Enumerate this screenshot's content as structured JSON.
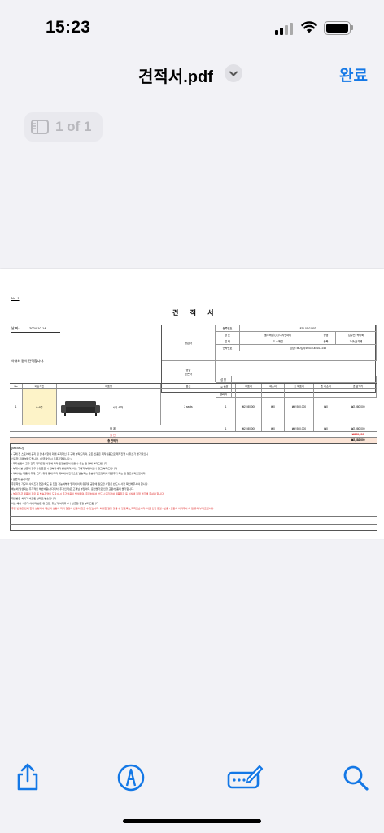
{
  "status_bar": {
    "time": "15:23"
  },
  "nav": {
    "title": "견적서.pdf",
    "done": "완료"
  },
  "pager": {
    "text": "1 of 1"
  },
  "doc": {
    "number": "No. 1",
    "heading": "견 적 서",
    "date_label": "날 짜:",
    "date_value": "2024-10-14",
    "greeting": "아래와 같이 견적합니다.",
    "supplier": {
      "side_label": "공급자",
      "recipient_label": "공급",
      "recipient_label2": "받는자",
      "reg_no_label": "등록번호",
      "reg_no": "826-01-01902",
      "name_label": "상 호",
      "name": "헬스매일 (주) 대치엔파니",
      "rep_label": "성명",
      "rep": "김수빈, 곽미화",
      "addr_label": "업 태",
      "addr": "도 소매업",
      "item_label": "종목",
      "item": "가구(상가쉐",
      "tel_label": "연락번호",
      "tel": "담당 : MD김라소 010-4544-7243",
      "r_name_label": "성 명",
      "r_addr_label": "주 소",
      "r_tel_label": "연락처"
    },
    "table": {
      "headers": [
        "No",
        "배송기간",
        "제품명",
        "옵션",
        "수량",
        "제품가",
        "배송비",
        "총 제품가",
        "총 배송비",
        "총 금액가"
      ],
      "row": {
        "no": "1",
        "delivery": "6~8주",
        "product": "시의 소파",
        "option": "2 seats",
        "qty": "1",
        "price": "₩2,980,000",
        "ship": "₩0",
        "total_price": "₩2,980,000",
        "total_ship": "₩0",
        "total": "₩2,980,000"
      },
      "subtotal_label": "합 계",
      "subtotal": {
        "qty": "1",
        "price": "₩2,980,000",
        "ship": "₩0",
        "total_price": "₩2,980,000",
        "total_ship": "₩0",
        "total": "₩2,980,000"
      },
      "discount_label": "할 인",
      "discount": "₩298,000",
      "grand_label": "총 견적가",
      "grand": "₩2,682,000"
    },
    "memo_title": "[MEMO]",
    "memo_lines": [
      {
        "text": "• 구매 전 스토어에 공지 된 안내사항에 대해 숙지하신 후 구매 부탁드리며, 모든 신품은 제작상품으로 제작진행 시 취소가 불가하오니",
        "red": false
      },
      {
        "text": "  신중한 구매 부탁드립니다. (입금확인 시 주문진행됩니다.)",
        "red": false
      },
      {
        "text": "• 제작상황에 공유 간혹 제작공정 사정에 따라 일정변동이 있을 수 있는 점 양해 부탁드립니다.",
        "red": false
      },
      {
        "text": "• 부재시 본 상품의 경우 수입품은 시 관부가세가 발생되며, 이는 구매자 부담이오니 참고 부탁드립니다.",
        "red": false
      },
      {
        "text": "• 해외사는 제품의 두께, 크기, 위개 등에 따라 제외에서 전국으로 발송되는 운송비가 조정되어 개별추가 되는 점 참고부탁드립니다.",
        "red": false
      },
      {
        "text": "• 운반시 공지사항",
        "red": false
      },
      {
        "text": "  주문하실 가구의 사이즈가 현관/복도 등 진입 가능여부와 엘리베이터 유무를 공란에 필요한 사항은 반드시 사전 확인해주셔야 합니다.",
        "red": false
      },
      {
        "text": "배송에 발생되는 추가적인 해반비용(사다리차, 추가인력)은 고객님 부담이며, 운반불가로 인한 교환/반품이 불가합니다.",
        "red": false
      },
      {
        "text": "• 부피가 큰 제품의 경우 꼭 발송지역의 도착시 시 추가비용이 발생되며, 주문처에서 반드시 대기하여 제품하자 등 이상에 직접 협조해 주셔야 합니다.",
        "red": true
      },
      {
        "text": "  재인발은 처리기 비조립 상태로 발송됩니다.",
        "red": false
      },
      {
        "text": "이는 해외 사유가 아니며 반품 및 교환, 취소가 어려우시니 신중한 결정 부탁드립니다.",
        "red": false
      },
      {
        "text": "  주문 변동은 단체 현지 상황이나 제반의 상황에 따라 일정에 변동이 있을 수 있습니다. 외래한 일정 맞춤 수 있도록 노력하겠습니다. 이로 인한 환불 / 반품 / 교환이 어려우니 이 점 유의 부탁드립니다.",
        "red": true
      }
    ]
  },
  "toolbar": {
    "share_icon": "share-icon",
    "markup_icon": "markup-pen-icon",
    "signature_icon": "signature-icon",
    "search_icon": "search-icon"
  },
  "colors": {
    "accent": "#1478e6",
    "background": "#f2f2f6",
    "delivery_cell": "#fdf3c8",
    "discount_red": "#d22"
  }
}
